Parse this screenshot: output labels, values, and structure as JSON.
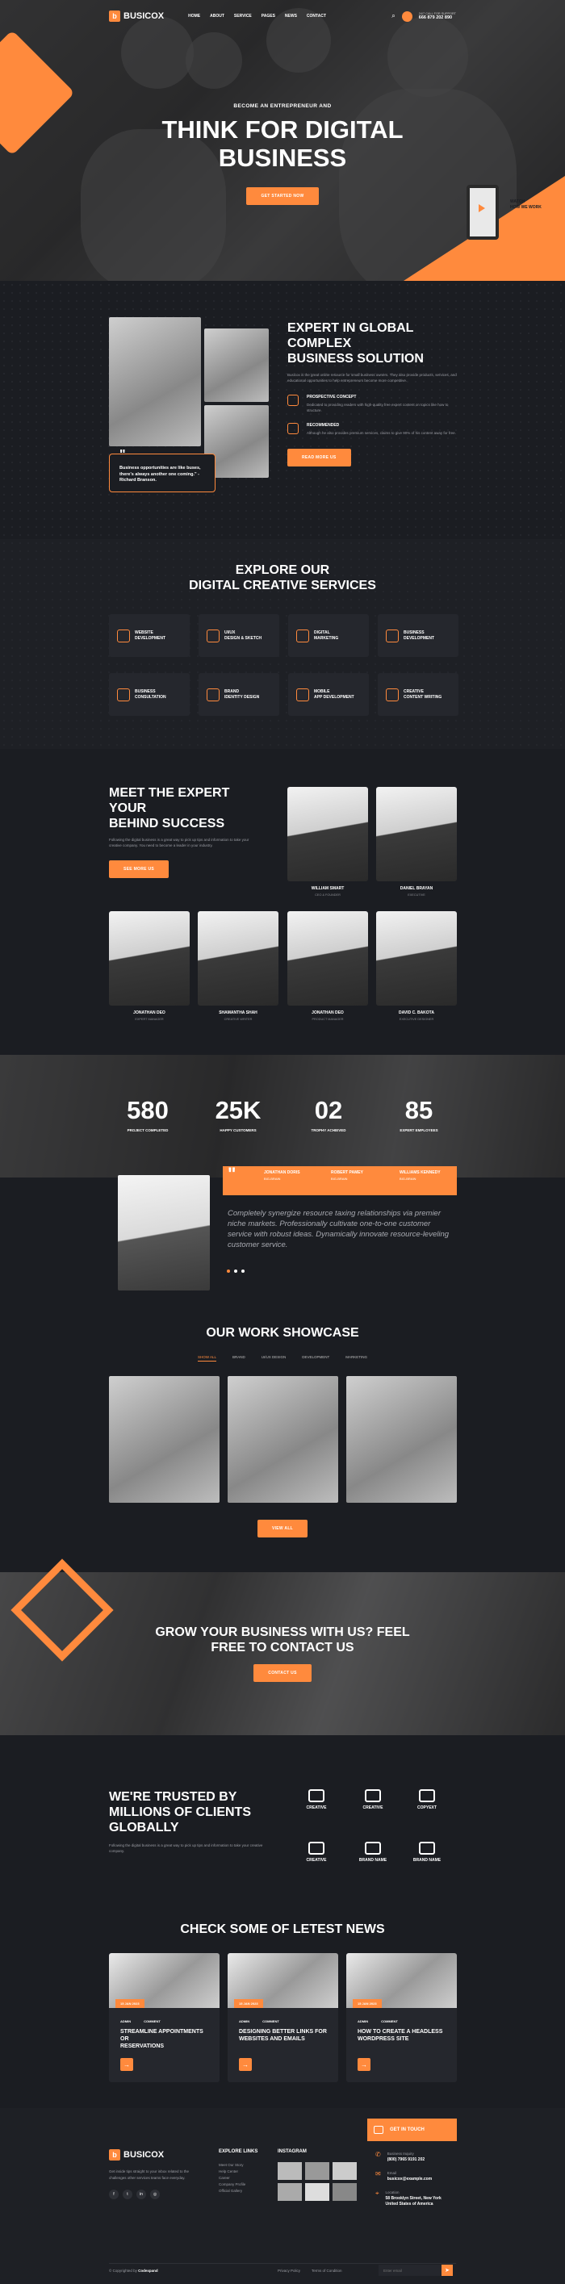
{
  "header": {
    "brand": "BUSICOX",
    "menu": [
      "HOME",
      "ABOUT",
      "SERVICE",
      "PAGES",
      "NEWS",
      "CONTACT"
    ],
    "support_label": "24/7 CALL FOR SUPPORT",
    "support_phone": "666 879 202 890"
  },
  "hero": {
    "kicker": "BECOME AN ENTREPRENEUR AND",
    "title_1": "THINK FOR DIGITAL",
    "title_2": "BUSINESS",
    "cta": "GET STARTED NOW",
    "video_label_1": "WATCH",
    "video_label_2": "HOW WE WORK"
  },
  "about": {
    "title_1": "EXPERT IN GLOBAL COMPLEX",
    "title_2": "BUSINESS SOLUTION",
    "desc": "Busicox is the great online resource for small business owners. They also provide products, services, and educational opportunities to help entrepreneurs become more competitive.",
    "items": [
      {
        "title": "PROSPECTIVE CONCEPT",
        "desc": "Dedicated to providing readers with high-quality free expert content on topics like how to structure."
      },
      {
        "title": "RECOMMENDED",
        "desc": "Although he also provides premium services, claims to give 90% of his content away for free."
      }
    ],
    "quote": "Business opportunities are like buses, there's always another one coming.\" - Richard Branson.",
    "cta": "READ MORE US"
  },
  "services": {
    "title_1": "EXPLORE OUR",
    "title_2": "DIGITAL CREATIVE SERVICES",
    "items": [
      [
        "WEBSITE",
        "DEVELOPMENT"
      ],
      [
        "UI/UX",
        "DESIGN & SKETCH"
      ],
      [
        "DIGITAL",
        "MARKETING"
      ],
      [
        "BUSINESS",
        "DEVELOPMENT"
      ],
      [
        "BUSINESS",
        "CONSULTATION"
      ],
      [
        "BRAND",
        "IDENTITY DESIGN"
      ],
      [
        "MOBILE",
        "APP DEVELOPMENT"
      ],
      [
        "CREATIVE",
        "CONTENT WRITING"
      ]
    ]
  },
  "team": {
    "title_1": "MEET THE EXPERT YOUR",
    "title_2": "BEHIND SUCCESS",
    "desc": "Following the digital business is a great way to pick up tips and information to take your creative company. You need to become a leader in your industry.",
    "cta": "SEE MORE US",
    "members": [
      {
        "name": "WILLIAM SMART",
        "role": "CEO & FOUNDER"
      },
      {
        "name": "DANIEL BRAYAN",
        "role": "EXECUTIVE"
      },
      {
        "name": "JONATHAN DEO",
        "role": "EXPERT MANAGER"
      },
      {
        "name": "SHAMANTHA SHAH",
        "role": "CREATIVE WRITER"
      },
      {
        "name": "JONATHAN DEO",
        "role": "PRODUCT MANAGER"
      },
      {
        "name": "DAVID C. BAKOTA",
        "role": "EXECUTIVE DESIGNER"
      }
    ]
  },
  "stats": [
    {
      "n": "580",
      "c": "PROJECT COMPLETED"
    },
    {
      "n": "25K",
      "c": "HAPPY CUSTOMERS"
    },
    {
      "n": "02",
      "c": "TROPHY ACHIEVED"
    },
    {
      "n": "85",
      "c": "EXPERT EMPLOYEES"
    }
  ],
  "testimonial": {
    "names": [
      {
        "n": "JONATHAN DORIS",
        "c": "BIG-BRAIN"
      },
      {
        "n": "ROBERT PAMEY",
        "c": "BIG-BRAIN"
      },
      {
        "n": "WILLIAMS KENNEDY",
        "c": "BIG-BRAIN"
      }
    ],
    "text": "Completely synergize resource taxing relationships via premier niche markets. Professionally cultivate one-to-one customer service with robust ideas. Dynamically innovate resource-leveling customer service."
  },
  "work": {
    "title": "OUR WORK SHOWCASE",
    "tabs": [
      "SHOW ALL",
      "BRAND",
      "UI/UX DESIGN",
      "DEVELOPMENT",
      "MARKETING"
    ],
    "cta": "VIEW ALL"
  },
  "contact": {
    "title_1": "GROW YOUR BUSINESS WITH US? FEEL",
    "title_2": "FREE TO CONTACT US",
    "cta": "CONTACT US"
  },
  "trusted": {
    "title_1": "WE'RE TRUSTED BY",
    "title_2": "MILLIONS OF CLIENTS",
    "title_3": "GLOBALLY",
    "desc": "Following the digital business is a great way to pick up tips and information to take your creative company.",
    "brands": [
      "CREATIVE",
      "CREATIVE",
      "COPYEXT",
      "CREATIVE",
      "BRAND NAME",
      "BRAND NAME"
    ]
  },
  "news": {
    "title": "CHECK SOME OF LETEST NEWS",
    "items": [
      {
        "date": "15 JAN 2023",
        "author": "ADMIN",
        "comment": "COMMENT",
        "title_1": "STREAMLINE APPOINTMENTS OR",
        "title_2": "RESERVATIONS"
      },
      {
        "date": "15 JAN 2023",
        "author": "ADMIN",
        "comment": "COMMENT",
        "title_1": "DESIGNING BETTER LINKS FOR",
        "title_2": "WEBSITES AND EMAILS"
      },
      {
        "date": "15 JAN 2023",
        "author": "ADMIN",
        "comment": "COMMENT",
        "title_1": "HOW TO CREATE A HEADLESS",
        "title_2": "WORDPRESS SITE"
      }
    ]
  },
  "footer": {
    "brand": "BUSICOX",
    "about": "Get inside tips straight to your inbox related to the challenges other services teams face everyday.",
    "links_title": "EXPLORE LINKS",
    "links": [
      "Meet Our Story",
      "Help Center",
      "Career",
      "Company Profile",
      "Official Gallery"
    ],
    "insta_title": "INSTAGRAM",
    "cta_title": "GET IN TOUCH",
    "phone_label": "Business Inquiry",
    "phone": "(800) 7965 9191 202",
    "email_label": "Email",
    "email": "busicox@example.com",
    "loc_label": "Location",
    "loc_1": "58 Brooklyn Street, New York",
    "loc_2": "United States of America",
    "copyright": "© Copyrighted by",
    "copyright_brand": "Codexpand",
    "privacy": "Privacy Policy",
    "terms": "Terms of Condition",
    "email_placeholder": "Enter email"
  }
}
